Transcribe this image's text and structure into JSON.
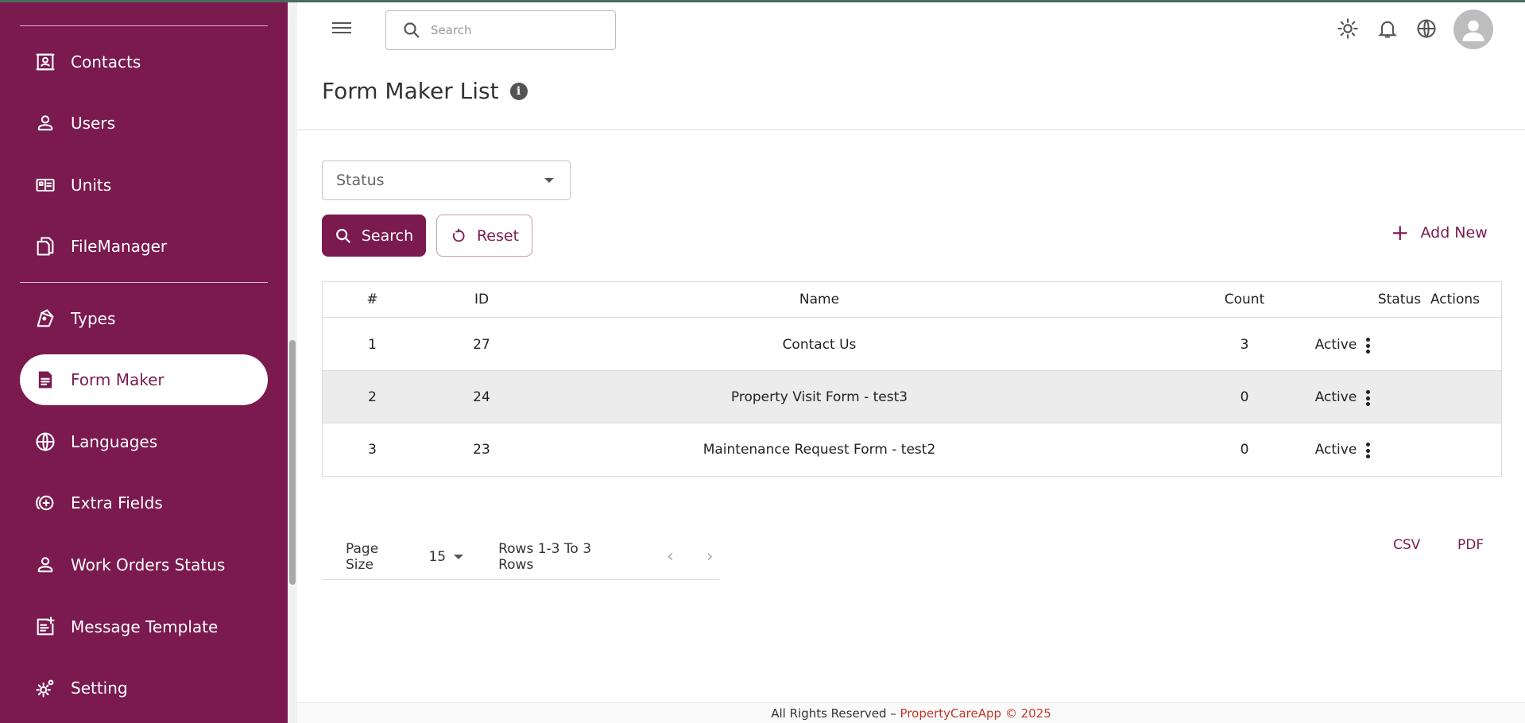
{
  "sidebar": {
    "items": [
      {
        "label": "Contacts",
        "icon": "contacts-icon"
      },
      {
        "label": "Users",
        "icon": "user-icon"
      },
      {
        "label": "Units",
        "icon": "units-icon"
      },
      {
        "label": "FileManager",
        "icon": "file-manager-icon"
      },
      {
        "label": "Types",
        "icon": "types-icon"
      },
      {
        "label": "Form Maker",
        "icon": "form-icon",
        "active": true
      },
      {
        "label": "Languages",
        "icon": "globe-icon"
      },
      {
        "label": "Extra Fields",
        "icon": "add-circle-icon"
      },
      {
        "label": "Work Orders Status",
        "icon": "user-icon"
      },
      {
        "label": "Message Template",
        "icon": "message-template-icon"
      },
      {
        "label": "Setting",
        "icon": "gear-icon"
      }
    ]
  },
  "header": {
    "search_placeholder": "Search",
    "icons": [
      "menu-icon",
      "sun-icon",
      "bell-icon",
      "globe-icon",
      "avatar"
    ]
  },
  "page": {
    "title": "Form Maker List"
  },
  "filters": {
    "status_placeholder": "Status",
    "search_label": "Search",
    "reset_label": "Reset",
    "add_new_label": "Add New"
  },
  "table": {
    "columns": [
      "#",
      "ID",
      "Name",
      "Count",
      "Status",
      "Actions"
    ],
    "rows": [
      {
        "num": "1",
        "id": "27",
        "name": "Contact Us",
        "count": "3",
        "status": "Active"
      },
      {
        "num": "2",
        "id": "24",
        "name": "Property Visit Form - test3",
        "count": "0",
        "status": "Active"
      },
      {
        "num": "3",
        "id": "23",
        "name": "Maintenance Request Form - test2",
        "count": "0",
        "status": "Active"
      }
    ]
  },
  "pagination": {
    "page_size_label": "Page Size",
    "page_size_value": "15",
    "rows_info": "Rows 1-3 To 3 Rows"
  },
  "export": {
    "csv": "CSV",
    "pdf": "PDF"
  },
  "footer": {
    "text": "All Rights Reserved – ",
    "brand": "PropertyCareApp © 2025"
  },
  "colors": {
    "brand": "#7a1a4f",
    "footer_brand": "#c0392b"
  }
}
